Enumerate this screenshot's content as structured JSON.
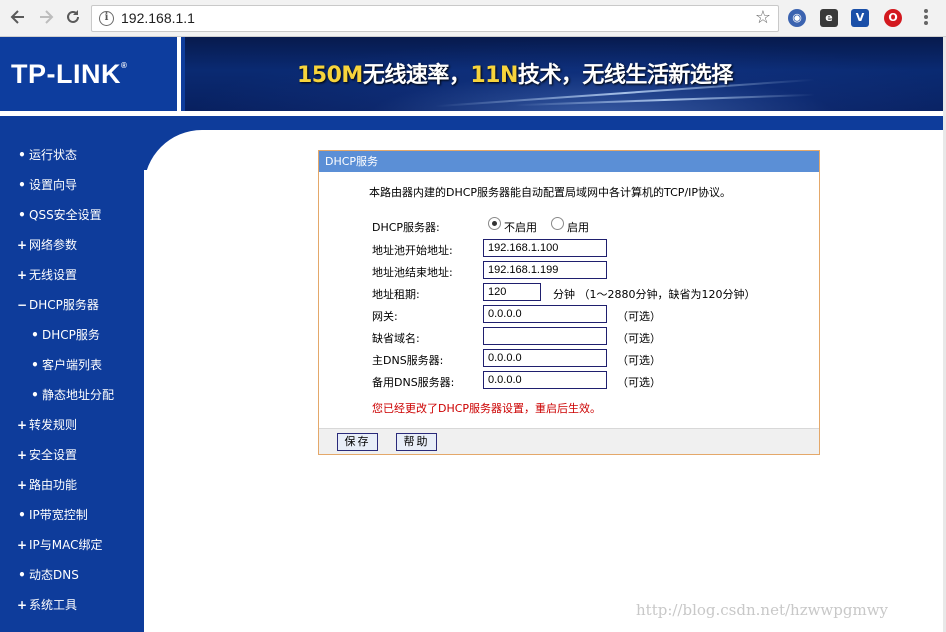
{
  "browser": {
    "url": "192.168.1.1",
    "back_icon": "arrow-left-icon",
    "forward_icon": "arrow-right-icon",
    "reload_icon": "reload-icon"
  },
  "header": {
    "logo": "TP-LINK",
    "slogan_a": "150M",
    "slogan_b": "无线速率，",
    "slogan_c": "11N",
    "slogan_d": "技术，无线生活新选择"
  },
  "sidebar": {
    "items": [
      {
        "marker": "•",
        "label": "运行状态"
      },
      {
        "marker": "•",
        "label": "设置向导"
      },
      {
        "marker": "•",
        "label": "QSS安全设置"
      },
      {
        "marker": "+",
        "label": "网络参数"
      },
      {
        "marker": "+",
        "label": "无线设置"
      },
      {
        "marker": "−",
        "label": "DHCP服务器"
      },
      {
        "marker": "•",
        "label": "DHCP服务"
      },
      {
        "marker": "•",
        "label": "客户端列表"
      },
      {
        "marker": "•",
        "label": "静态地址分配"
      },
      {
        "marker": "+",
        "label": "转发规则"
      },
      {
        "marker": "+",
        "label": "安全设置"
      },
      {
        "marker": "+",
        "label": "路由功能"
      },
      {
        "marker": "•",
        "label": "IP带宽控制"
      },
      {
        "marker": "+",
        "label": "IP与MAC绑定"
      },
      {
        "marker": "•",
        "label": "动态DNS"
      },
      {
        "marker": "+",
        "label": "系统工具"
      }
    ]
  },
  "panel": {
    "title": "DHCP服务",
    "intro": "本路由器内建的DHCP服务器能自动配置局域网中各计算机的TCP/IP协议。",
    "dhcp_label": "DHCP服务器:",
    "disable_label": "不启用",
    "enable_label": "启用",
    "start_label": "地址池开始地址:",
    "start_value": "192.168.1.100",
    "end_label": "地址池结束地址:",
    "end_value": "192.168.1.199",
    "lease_label": "地址租期:",
    "lease_value": "120",
    "lease_hint": "分钟 （1～2880分钟，缺省为120分钟）",
    "gateway_label": "网关:",
    "gateway_value": "0.0.0.0",
    "domain_label": "缺省域名:",
    "domain_value": "",
    "dns1_label": "主DNS服务器:",
    "dns1_value": "0.0.0.0",
    "dns2_label": "备用DNS服务器:",
    "dns2_value": "0.0.0.0",
    "optional": "（可选）",
    "warning": "您已经更改了DHCP服务器设置，重启后生效。",
    "save_label": "保存",
    "help_label": "帮助"
  },
  "watermark": "http://blog.csdn.net/hzwwpgmwy"
}
